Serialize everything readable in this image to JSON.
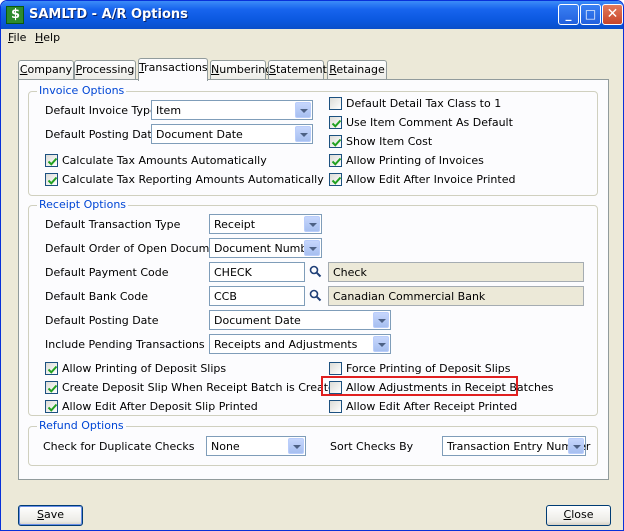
{
  "window": {
    "title": "SAMLTD - A/R Options",
    "controls": {
      "minimize": "_",
      "maximize": "□",
      "close": "✕"
    }
  },
  "menu": [
    "File",
    "Help"
  ],
  "tabs": [
    "Company",
    "Processing",
    "Transactions",
    "Numbering",
    "Statement",
    "Retainage"
  ],
  "active_tab": "Transactions",
  "invoice_options": {
    "legend": "Invoice Options",
    "default_invoice_type_label": "Default Invoice Type",
    "default_invoice_type_value": "Item",
    "default_posting_date_label": "Default Posting Date",
    "default_posting_date_value": "Document Date",
    "calc_tax_amounts": {
      "label": "Calculate Tax Amounts Automatically",
      "checked": true
    },
    "calc_tax_reporting": {
      "label": "Calculate Tax Reporting Amounts Automatically",
      "checked": true
    },
    "default_detail_tax_class": {
      "label": "Default Detail Tax Class to 1",
      "checked": false
    },
    "use_item_comment": {
      "label": "Use Item Comment As Default",
      "checked": true
    },
    "show_item_cost": {
      "label": "Show Item Cost",
      "checked": true
    },
    "allow_printing_invoices": {
      "label": "Allow Printing of Invoices",
      "checked": true
    },
    "allow_edit_after_invoice": {
      "label": "Allow Edit After Invoice Printed",
      "checked": true
    }
  },
  "receipt_options": {
    "legend": "Receipt Options",
    "default_transaction_type_label": "Default Transaction Type",
    "default_transaction_type_value": "Receipt",
    "default_order_label": "Default Order of Open Documents",
    "default_order_value": "Document Number",
    "default_payment_code_label": "Default Payment Code",
    "default_payment_code_value": "CHECK",
    "default_payment_code_desc": "Check",
    "default_bank_code_label": "Default Bank Code",
    "default_bank_code_value": "CCB",
    "default_bank_code_desc": "Canadian Commercial Bank",
    "default_posting_date_label": "Default Posting Date",
    "default_posting_date_value": "Document Date",
    "include_pending_label": "Include Pending Transactions",
    "include_pending_value": "Receipts and Adjustments",
    "allow_printing_deposit_slips": {
      "label": "Allow Printing of Deposit Slips",
      "checked": true
    },
    "create_deposit_slip": {
      "label": "Create Deposit Slip When Receipt Batch is Created",
      "checked": true
    },
    "allow_edit_after_deposit": {
      "label": "Allow Edit After Deposit Slip Printed",
      "checked": true
    },
    "force_printing_deposit_slips": {
      "label": "Force Printing of Deposit Slips",
      "checked": false
    },
    "allow_adjustments": {
      "label": "Allow Adjustments in Receipt Batches",
      "checked": false
    },
    "allow_edit_after_receipt": {
      "label": "Allow Edit After Receipt Printed",
      "checked": false
    }
  },
  "refund_options": {
    "legend": "Refund Options",
    "check_duplicate_label": "Check for Duplicate Checks",
    "check_duplicate_value": "None",
    "sort_checks_label": "Sort Checks By",
    "sort_checks_value": "Transaction Entry Number"
  },
  "buttons": {
    "save": "Save",
    "close": "Close"
  },
  "colors": {
    "title_bar": "#0b58df",
    "group_legend": "#0046d5",
    "highlight": "#e02020",
    "window_bg": "#ece9d8"
  }
}
